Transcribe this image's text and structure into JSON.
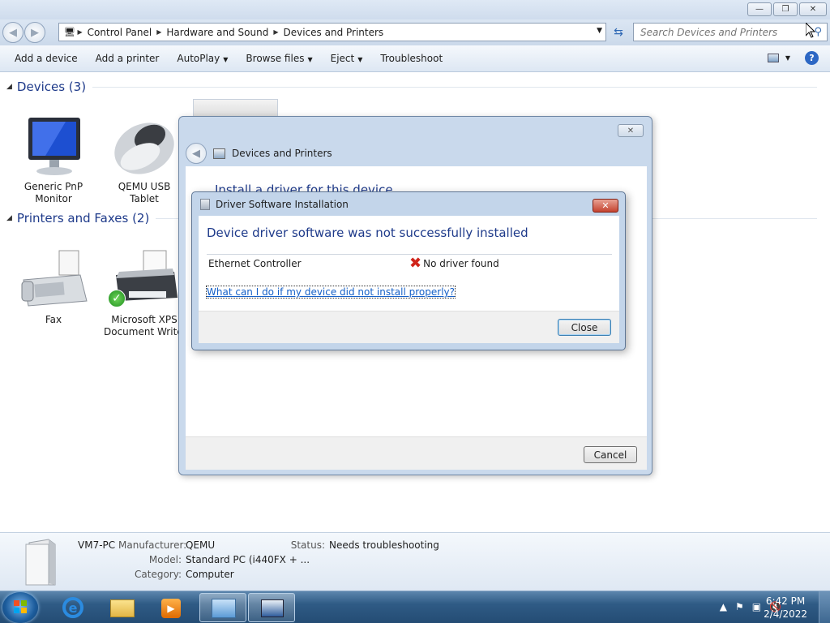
{
  "window": {
    "minimize_glyph": "—",
    "maximize_glyph": "❐",
    "close_glyph": "✕"
  },
  "address": {
    "crumbs": [
      "Control Panel",
      "Hardware and Sound",
      "Devices and Printers"
    ],
    "search_placeholder": "Search Devices and Printers"
  },
  "toolbar": {
    "add_device": "Add a device",
    "add_printer": "Add a printer",
    "autoplay": "AutoPlay",
    "browse_files": "Browse files",
    "eject": "Eject",
    "troubleshoot": "Troubleshoot"
  },
  "groups": {
    "devices": {
      "header": "Devices (3)",
      "items": [
        {
          "line1": "Generic PnP",
          "line2": "Monitor"
        },
        {
          "line1": "QEMU USB",
          "line2": "Tablet"
        }
      ]
    },
    "printers": {
      "header": "Printers and Faxes (2)",
      "items": [
        {
          "line1": "Fax",
          "line2": ""
        },
        {
          "line1": "Microsoft XPS",
          "line2": "Document Write"
        }
      ]
    }
  },
  "wizard": {
    "title": "Devices and Printers",
    "heading": "Install a driver for this device",
    "cancel_label": "Cancel"
  },
  "driver_dialog": {
    "title": "Driver Software Installation",
    "heading": "Device driver software was not successfully installed",
    "device_name": "Ethernet Controller",
    "status": "No driver found",
    "help_link": "What can I do if my device did not install properly?",
    "close_label": "Close"
  },
  "details": {
    "pc_name": "VM7-PC",
    "manufacturer_label": "Manufacturer:",
    "manufacturer": "QEMU",
    "model_label": "Model:",
    "model": "Standard PC (i440FX + ...",
    "category_label": "Category:",
    "category": "Computer",
    "status_label": "Status:",
    "status": "Needs troubleshooting"
  },
  "taskbar": {
    "time": "6:42 PM",
    "date": "2/4/2022"
  },
  "colors": {
    "heading_blue": "#1e3a8a",
    "link_blue": "#1560c8",
    "error_red": "#d0251b"
  }
}
